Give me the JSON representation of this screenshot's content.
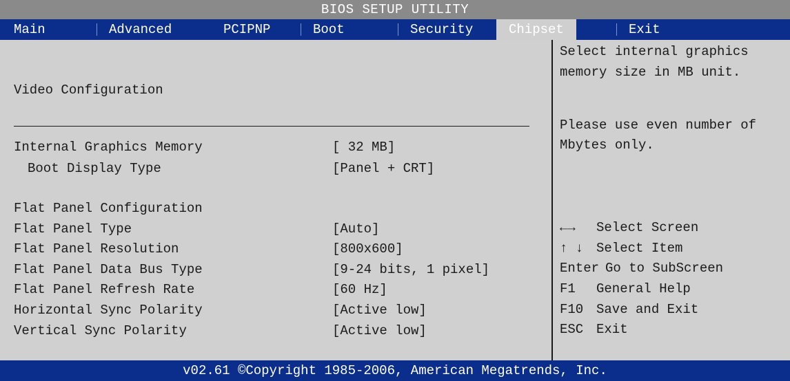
{
  "title": "BIOS SETUP UTILITY",
  "tabs": [
    {
      "label": "Main"
    },
    {
      "label": "Advanced"
    },
    {
      "label": "PCIPNP"
    },
    {
      "label": "Boot"
    },
    {
      "label": "Security"
    },
    {
      "label": "Chipset"
    },
    {
      "label": "Exit"
    }
  ],
  "active_tab": "Chipset",
  "section_title": "Video Configuration",
  "settings": [
    {
      "label": "Internal Graphics Memory",
      "value": "[ 32 MB]"
    },
    {
      "label": "Boot Display Type",
      "value": "[Panel + CRT]"
    },
    {
      "label": "Flat Panel Configuration",
      "value": ""
    },
    {
      "label": "Flat Panel Type",
      "value": "[Auto]"
    },
    {
      "label": "Flat Panel Resolution",
      "value": "[800x600]"
    },
    {
      "label": "Flat Panel Data Bus Type",
      "value": "[9-24 bits, 1 pixel]"
    },
    {
      "label": "Flat Panel Refresh Rate",
      "value": "[60 Hz]"
    },
    {
      "label": "Horizontal Sync Polarity",
      "value": "[Active low]"
    },
    {
      "label": "Vertical Sync Polarity",
      "value": "[Active low]"
    }
  ],
  "help": {
    "lines": [
      "Select internal graphics",
      "memory size in MB unit.",
      "Please use even number of",
      "Mbytes only."
    ],
    "keys": [
      {
        "key": "←→",
        "desc": "Select Screen"
      },
      {
        "key": "↑ ↓",
        "desc": "Select Item"
      },
      {
        "key": "Enter",
        "desc": "Go to SubScreen"
      },
      {
        "key": "F1",
        "desc": "General Help"
      },
      {
        "key": "F10",
        "desc": "Save and Exit"
      },
      {
        "key": "ESC",
        "desc": "Exit"
      }
    ]
  },
  "footer": "v02.61 ©Copyright 1985-2006, American Megatrends, Inc.",
  "colors": {
    "tab_bar": "#0b2e8c",
    "title_bar": "#8a8a8a",
    "panel": "#d0d0d0",
    "text": "#1a1a1a"
  }
}
